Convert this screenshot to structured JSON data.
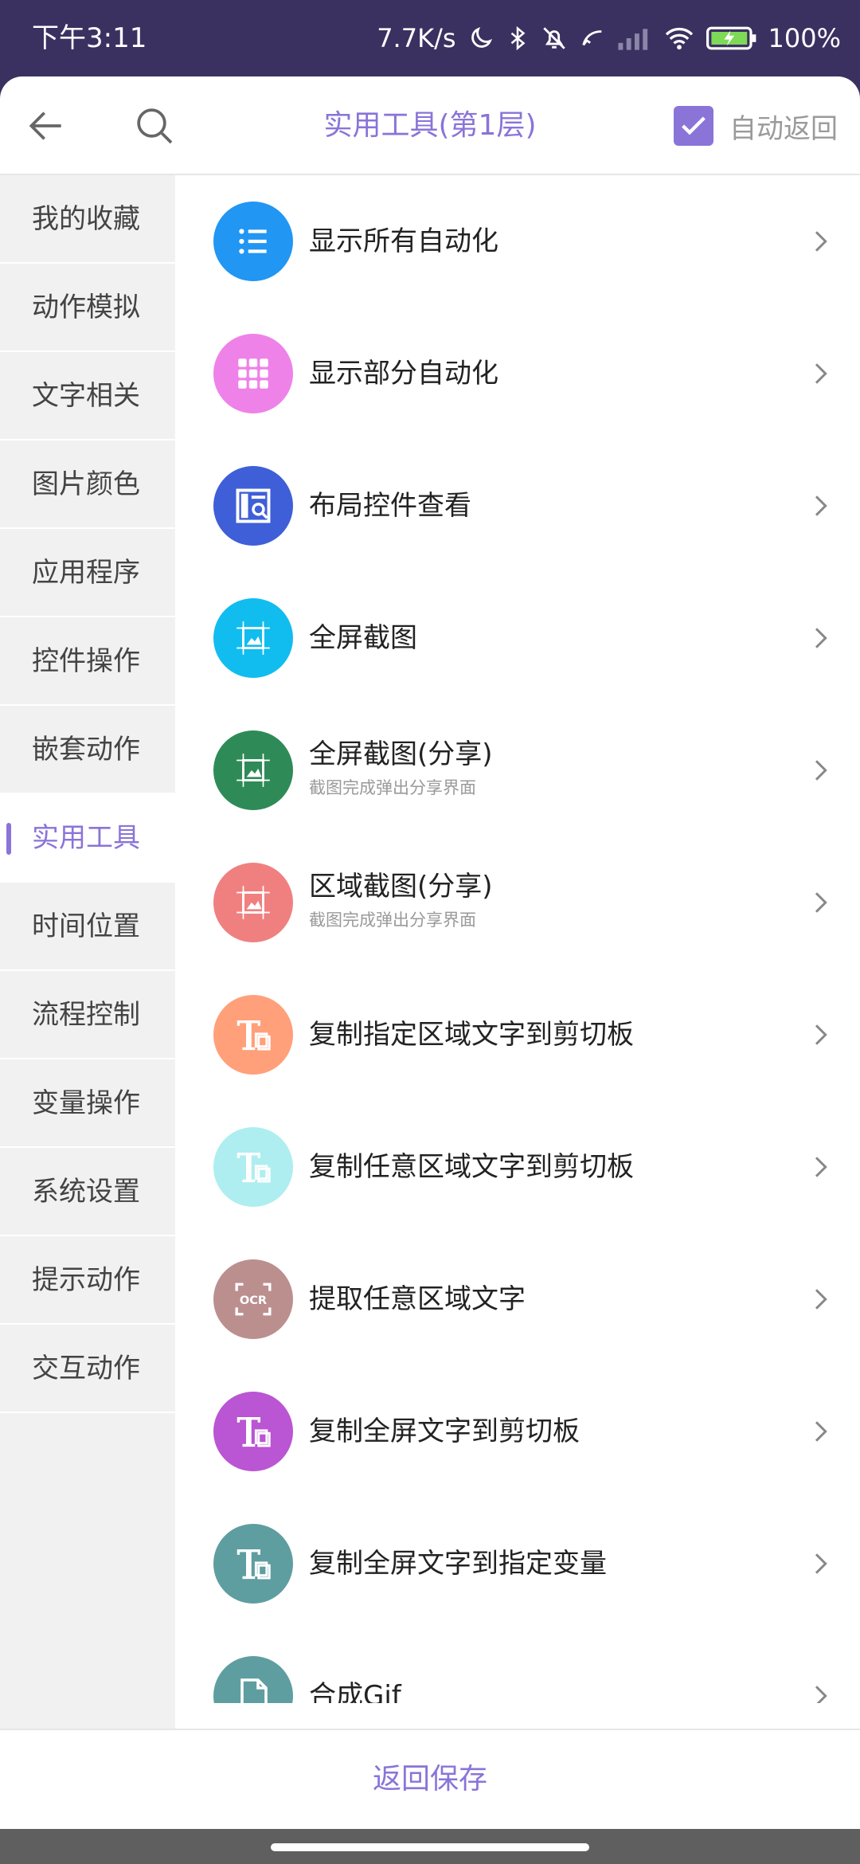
{
  "status_bar": {
    "time": "下午3:11",
    "net_speed": "7.7K/s",
    "battery": "100%"
  },
  "header": {
    "title": "实用工具(第1层)",
    "auto_return_label": "自动返回",
    "auto_return_checked": true
  },
  "sidebar": {
    "items": [
      {
        "label": "我的收藏"
      },
      {
        "label": "动作模拟"
      },
      {
        "label": "文字相关"
      },
      {
        "label": "图片颜色"
      },
      {
        "label": "应用程序"
      },
      {
        "label": "控件操作"
      },
      {
        "label": "嵌套动作"
      },
      {
        "label": "实用工具",
        "active": true
      },
      {
        "label": "时间位置"
      },
      {
        "label": "流程控制"
      },
      {
        "label": "变量操作"
      },
      {
        "label": "系统设置"
      },
      {
        "label": "提示动作"
      },
      {
        "label": "交互动作"
      }
    ]
  },
  "actions": [
    {
      "title": "显示所有自动化",
      "icon": "list-icon",
      "color": "#2196f3"
    },
    {
      "title": "显示部分自动化",
      "icon": "grid-icon",
      "color": "#ee82e8"
    },
    {
      "title": "布局控件查看",
      "icon": "layout-inspect-icon",
      "color": "#3f5fd8"
    },
    {
      "title": "全屏截图",
      "icon": "screenshot-icon",
      "color": "#11bdef"
    },
    {
      "title": "全屏截图(分享)",
      "subtitle": "截图完成弹出分享界面",
      "icon": "screenshot-icon",
      "color": "#2e8b57"
    },
    {
      "title": "区域截图(分享)",
      "subtitle": "截图完成弹出分享界面",
      "icon": "screenshot-icon",
      "color": "#f08080"
    },
    {
      "title": "复制指定区域文字到剪切板",
      "icon": "text-copy-icon",
      "color": "#ffa07a"
    },
    {
      "title": "复制任意区域文字到剪切板",
      "icon": "text-copy-icon",
      "color": "#aeeef0"
    },
    {
      "title": "提取任意区域文字",
      "icon": "ocr-icon",
      "color": "#bc8f8f"
    },
    {
      "title": "复制全屏文字到剪切板",
      "icon": "text-copy-icon",
      "color": "#ba55d3"
    },
    {
      "title": "复制全屏文字到指定变量",
      "icon": "text-copy-icon",
      "color": "#5f9ea0"
    },
    {
      "title": "合成Gif",
      "icon": "file-icon",
      "color": "#5f9ea0"
    }
  ],
  "footer": {
    "save_label": "返回保存"
  },
  "colors": {
    "accent": "#8a74d8",
    "status_bar": "#3b3160"
  }
}
